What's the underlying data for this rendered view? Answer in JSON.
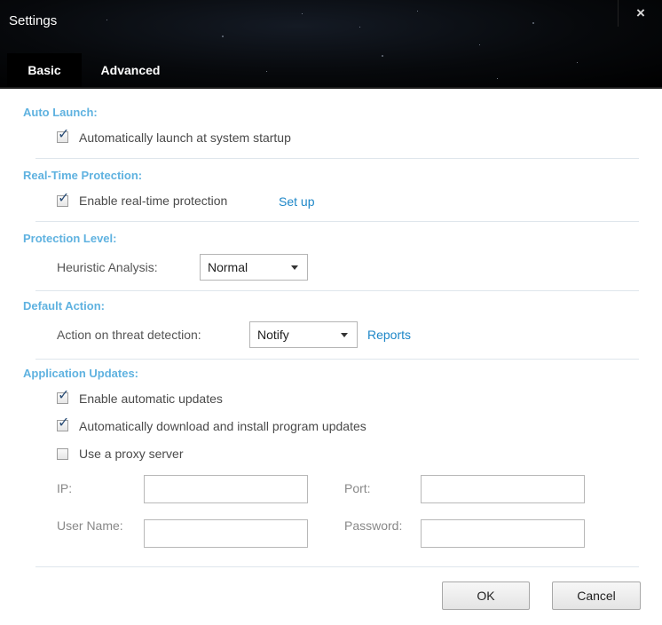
{
  "window": {
    "title": "Settings",
    "close_icon": "×"
  },
  "tabs": [
    {
      "label": "Basic",
      "active": true
    },
    {
      "label": "Advanced",
      "active": false
    }
  ],
  "sections": {
    "auto_launch": {
      "title": "Auto Launch:",
      "startup": {
        "label": "Automatically launch at system startup",
        "checked": true
      }
    },
    "realtime": {
      "title": "Real-Time Protection:",
      "enable": {
        "label": "Enable real-time protection",
        "checked": true
      },
      "setup_link": "Set up"
    },
    "protection_level": {
      "title": "Protection Level:",
      "heuristic_label": "Heuristic Analysis:",
      "heuristic_value": "Normal"
    },
    "default_action": {
      "title": "Default Action:",
      "action_label": "Action on threat detection:",
      "action_value": "Notify",
      "reports_link": "Reports"
    },
    "updates": {
      "title": "Application Updates:",
      "auto_updates": {
        "label": "Enable automatic updates",
        "checked": true
      },
      "auto_install": {
        "label": "Automatically download and install program updates",
        "checked": true
      },
      "proxy": {
        "label": "Use a proxy server",
        "checked": false
      },
      "ip_label": "IP:",
      "port_label": "Port:",
      "username_label": "User Name:",
      "password_label": "Password:",
      "ip_value": "",
      "port_value": "",
      "username_value": "",
      "password_value": ""
    }
  },
  "buttons": {
    "ok": "OK",
    "cancel": "Cancel"
  },
  "colors": {
    "section_title": "#5fb2e0",
    "link": "#1e87c8",
    "header_bg": "#07090c"
  }
}
